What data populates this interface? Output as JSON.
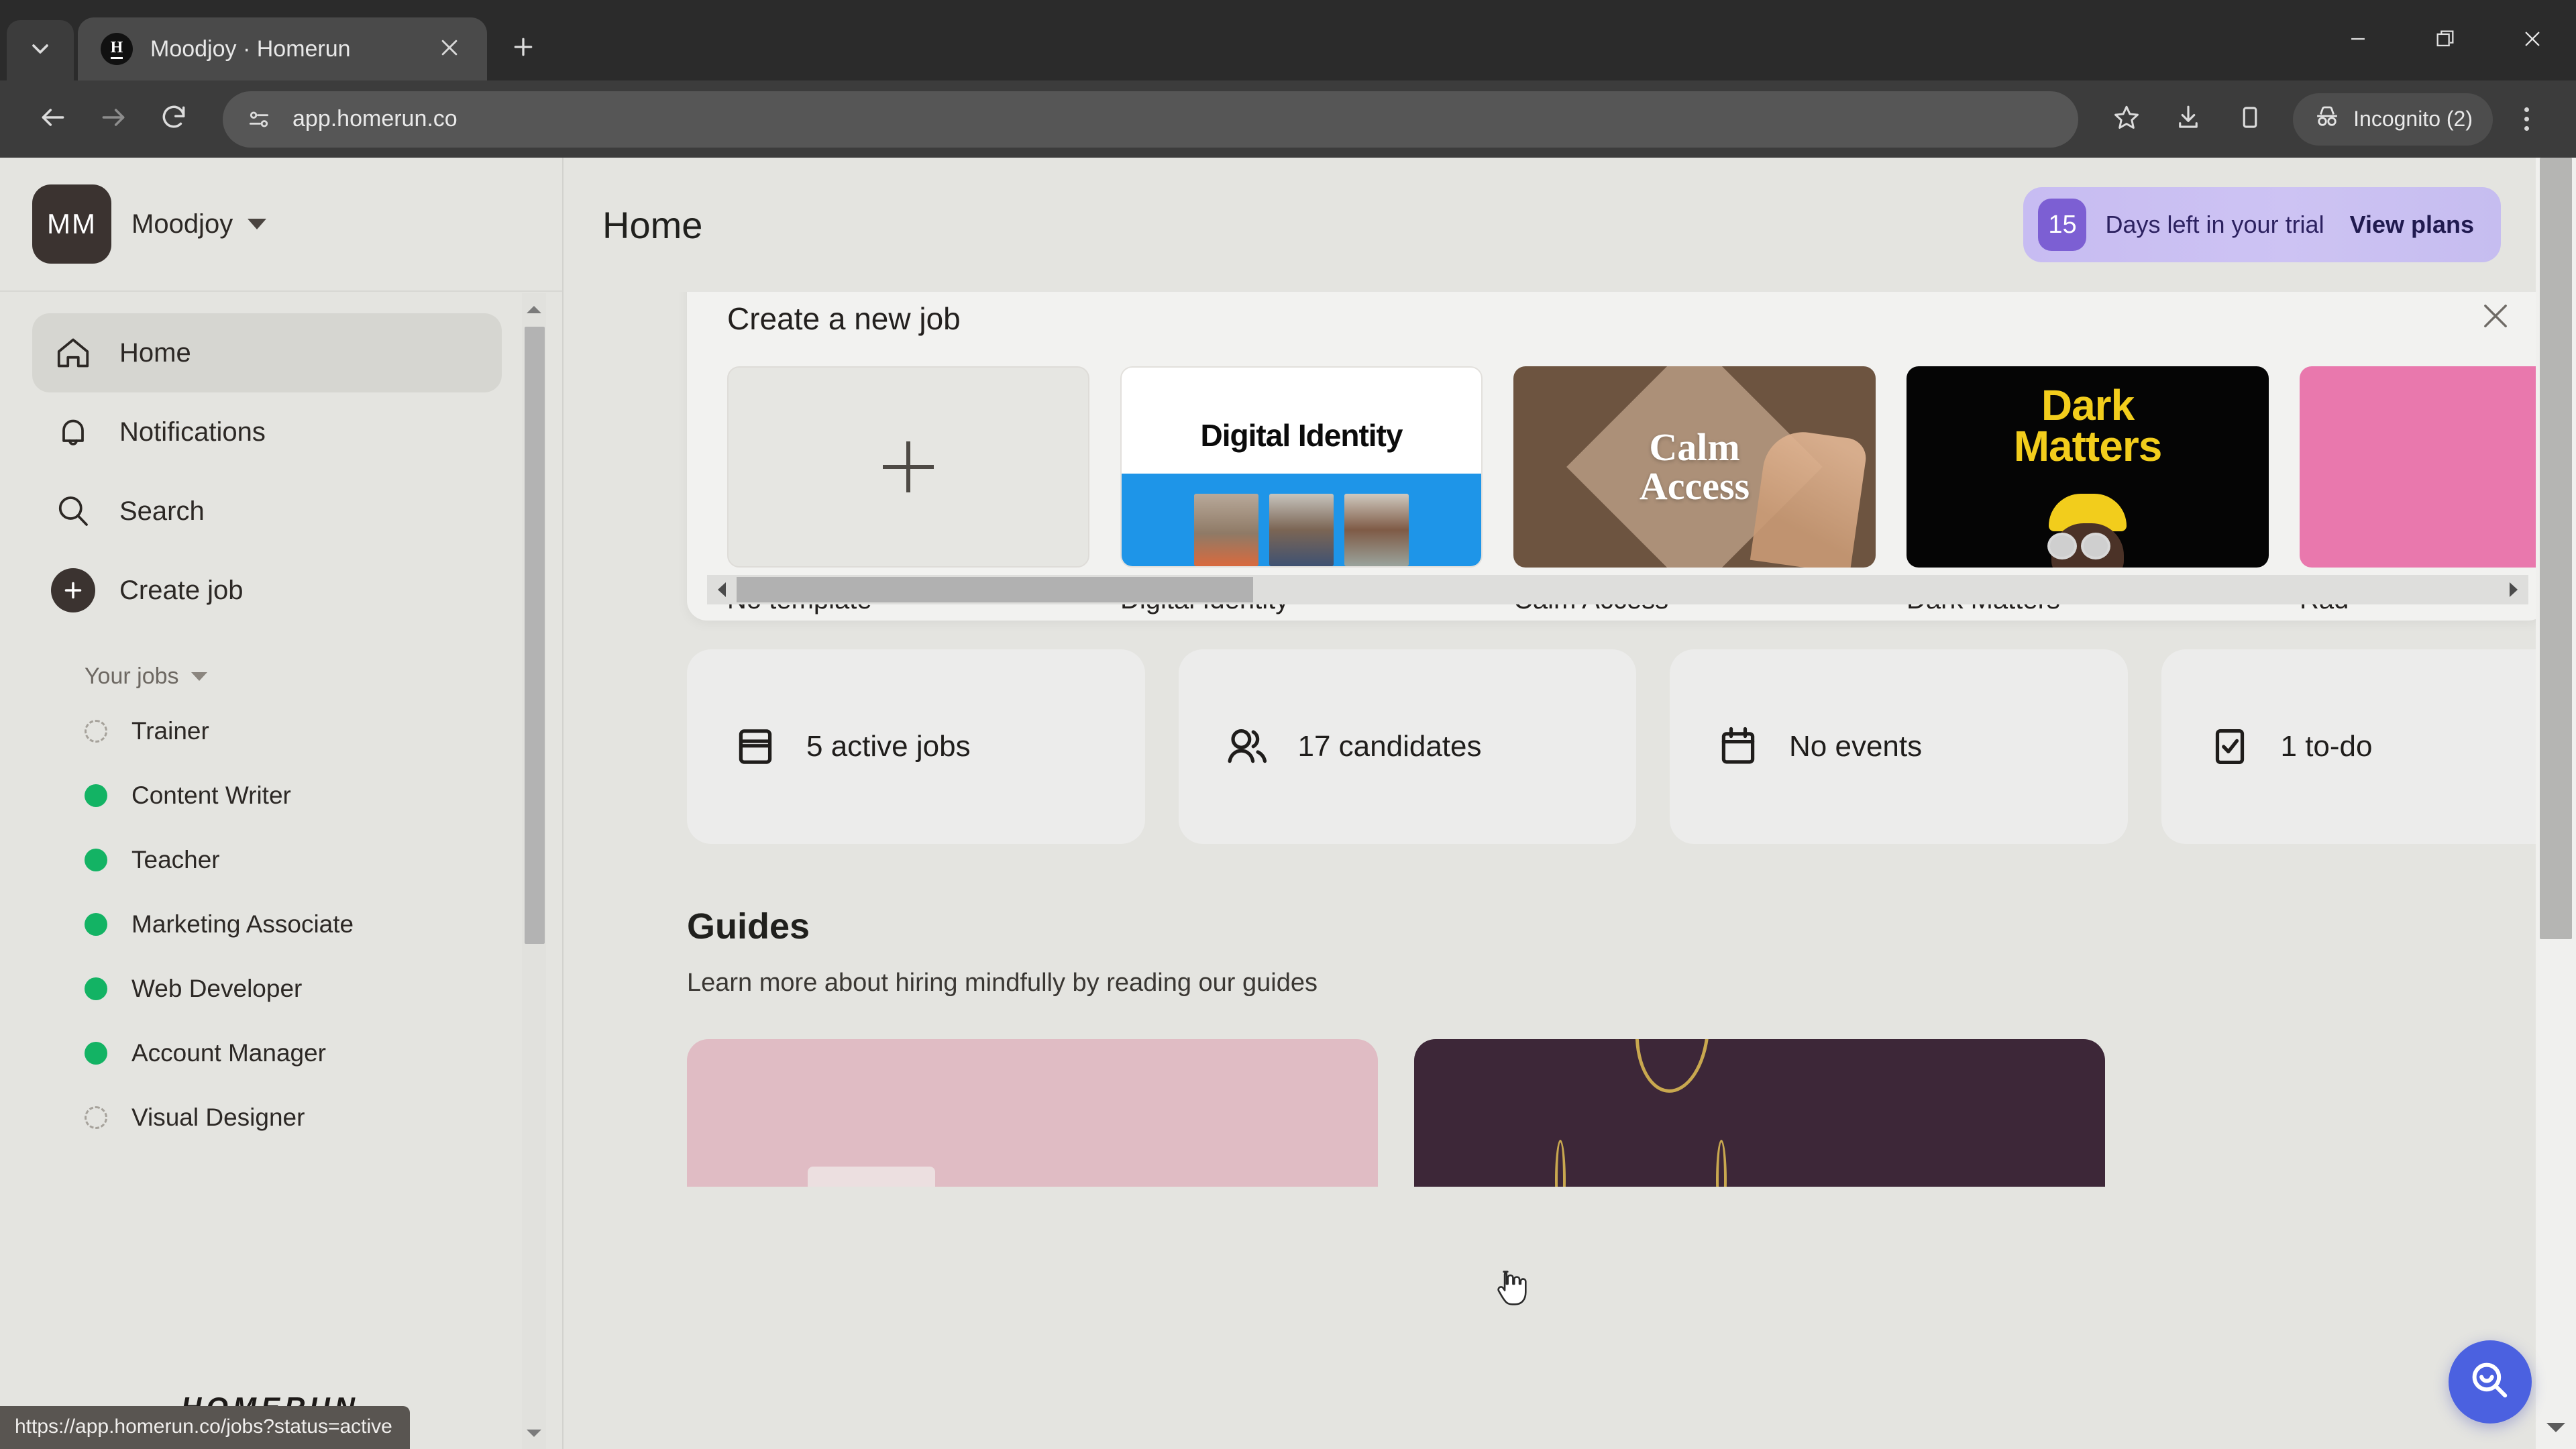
{
  "browser": {
    "tab": {
      "title": "Moodjoy · Homerun",
      "favicon_letter": "H"
    },
    "tablist_icon": "chevron-down-icon",
    "new_tab_icon": "plus-icon",
    "back_icon": "arrow-left-icon",
    "forward_icon": "arrow-right-icon",
    "reload_icon": "reload-icon",
    "site_info_icon": "tune-icon",
    "url": "app.homerun.co",
    "bookmark_icon": "star-icon",
    "download_icon": "download-icon",
    "sidepanel_icon": "side-panel-icon",
    "incognito_label": "Incognito (2)",
    "menu_icon": "three-dots-icon",
    "window": {
      "minimize": "minimize-icon",
      "maximize": "restore-icon",
      "close": "close-icon"
    }
  },
  "status_bar": {
    "url": "https://app.homerun.co/jobs?status=active"
  },
  "sidebar": {
    "org": {
      "initials": "MM",
      "name": "Moodjoy"
    },
    "nav": [
      {
        "label": "Home",
        "icon": "home-icon",
        "active": true
      },
      {
        "label": "Notifications",
        "icon": "bell-icon",
        "active": false
      },
      {
        "label": "Search",
        "icon": "search-icon",
        "active": false
      },
      {
        "label": "Create job",
        "icon": "plus-circle-icon",
        "active": false
      }
    ],
    "jobs_section_label": "Your jobs",
    "jobs": [
      {
        "label": "Trainer",
        "status": "draft"
      },
      {
        "label": "Content Writer",
        "status": "active"
      },
      {
        "label": "Teacher",
        "status": "active"
      },
      {
        "label": "Marketing Associate",
        "status": "active"
      },
      {
        "label": "Web Developer",
        "status": "active"
      },
      {
        "label": "Account Manager",
        "status": "active"
      },
      {
        "label": "Visual Designer",
        "status": "draft"
      }
    ],
    "logo": "HOMERUN"
  },
  "header": {
    "page_title": "Home",
    "trial": {
      "days": "15",
      "text": "Days left in your trial",
      "link": "View plans"
    }
  },
  "templates_panel": {
    "title": "Create a new job",
    "close_icon": "close-icon",
    "items": [
      {
        "name": "No template",
        "kind": "placeholder"
      },
      {
        "name": "Digital Identity",
        "kind": "image",
        "title_on_thumb": "Digital Identity"
      },
      {
        "name": "Calm Access",
        "kind": "image",
        "title_on_thumb": "Calm\nAccess"
      },
      {
        "name": "Dark Matters",
        "kind": "image",
        "title_on_thumb": "Dark\nMatters"
      },
      {
        "name": "Rad",
        "kind": "image",
        "title_on_thumb": ""
      }
    ]
  },
  "stats": [
    {
      "label": "5 active jobs",
      "icon": "jobs-board-icon"
    },
    {
      "label": "17 candidates",
      "icon": "people-icon"
    },
    {
      "label": "No events",
      "icon": "calendar-icon"
    },
    {
      "label": "1 to-do",
      "icon": "checkbox-icon"
    }
  ],
  "guides": {
    "title": "Guides",
    "subtitle": "Learn more about hiring mindfully by reading our guides",
    "cards": [
      {
        "color": "#e0bcc4"
      },
      {
        "color": "#3d2738"
      }
    ]
  },
  "fab": {
    "icon": "search-smile-icon"
  },
  "colors": {
    "accent_blue": "#4b61e0",
    "trial_purple": "#7c5fd3",
    "active_green": "#13b364",
    "page_bg": "#e4e4e0"
  }
}
